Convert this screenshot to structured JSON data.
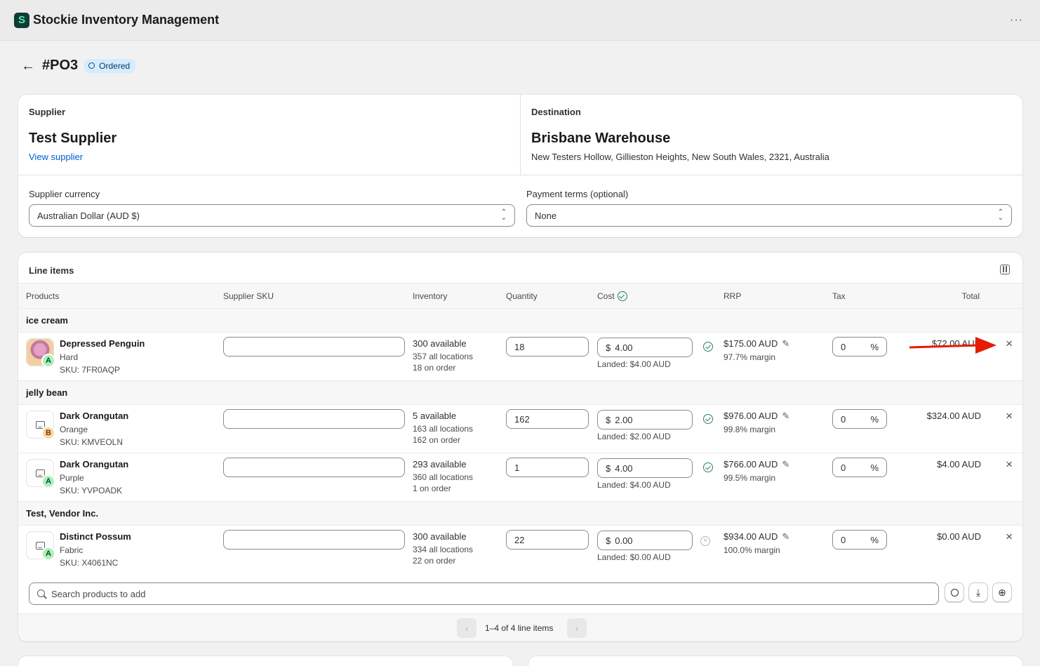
{
  "app": {
    "logo_letter": "S",
    "title": "Stockie Inventory Management",
    "more": "···"
  },
  "header": {
    "back": "←",
    "title": "#PO3",
    "status": "Ordered"
  },
  "supplier": {
    "label": "Supplier",
    "name": "Test Supplier",
    "link": "View supplier"
  },
  "destination": {
    "label": "Destination",
    "name": "Brisbane Warehouse",
    "address": "New Testers Hollow, Gillieston Heights, New South Wales, 2321, Australia"
  },
  "currency": {
    "label": "Supplier currency",
    "value": "Australian Dollar (AUD $)"
  },
  "payment_terms": {
    "label": "Payment terms (optional)",
    "value": "None"
  },
  "line_items": {
    "title": "Line items",
    "columns": {
      "products": "Products",
      "sku": "Supplier SKU",
      "inventory": "Inventory",
      "quantity": "Quantity",
      "cost": "Cost",
      "rrp": "RRP",
      "tax": "Tax",
      "total": "Total"
    },
    "groups": [
      "ice cream",
      "jelly bean",
      "Test, Vendor Inc."
    ],
    "rows": [
      {
        "name": "Depressed Penguin",
        "variant": "Hard",
        "sku": "SKU: 7FR0AQP",
        "grade": "A",
        "available": "300 available",
        "all_locations": "357 all locations",
        "on_order": "18 on order",
        "quantity": "18",
        "cost_prefix": "$",
        "cost": "4.00",
        "landed": "Landed: $4.00 AUD",
        "rrp": "$175.00 AUD",
        "margin": "97.7% margin",
        "tax": "0",
        "tax_unit": "%",
        "total": "$72.00 AUD"
      },
      {
        "name": "Dark Orangutan",
        "variant": "Orange",
        "sku": "SKU: KMVEOLN",
        "grade": "B",
        "available": "5 available",
        "all_locations": "163 all locations",
        "on_order": "162 on order",
        "quantity": "162",
        "cost_prefix": "$",
        "cost": "2.00",
        "landed": "Landed: $2.00 AUD",
        "rrp": "$976.00 AUD",
        "margin": "99.8% margin",
        "tax": "0",
        "tax_unit": "%",
        "total": "$324.00 AUD"
      },
      {
        "name": "Dark Orangutan",
        "variant": "Purple",
        "sku": "SKU: YVPOADK",
        "grade": "A",
        "available": "293 available",
        "all_locations": "360 all locations",
        "on_order": "1 on order",
        "quantity": "1",
        "cost_prefix": "$",
        "cost": "4.00",
        "landed": "Landed: $4.00 AUD",
        "rrp": "$766.00 AUD",
        "margin": "99.5% margin",
        "tax": "0",
        "tax_unit": "%",
        "total": "$4.00 AUD"
      },
      {
        "name": "Distinct Possum",
        "variant": "Fabric",
        "sku": "SKU: X4061NC",
        "grade": "A",
        "available": "300 available",
        "all_locations": "334 all locations",
        "on_order": "22 on order",
        "quantity": "22",
        "cost_prefix": "$",
        "cost": "0.00",
        "landed": "Landed: $0.00 AUD",
        "rrp": "$934.00 AUD",
        "margin": "100.0% margin",
        "tax": "0",
        "tax_unit": "%",
        "total": "$0.00 AUD"
      }
    ],
    "search_placeholder": "Search products to add",
    "pagination": "1–4 of 4 line items"
  },
  "icons": {
    "remove": "×",
    "pencil": "✎",
    "prev": "‹",
    "next": "›",
    "chevrons": "⌃⌄",
    "download": "⤓",
    "add": "⊕",
    "x_small": "×"
  },
  "colors": {
    "accent": "#005bd3",
    "success": "#29845a",
    "badge_bg": "#d5ebff",
    "annotation_arrow": "#e51c00"
  }
}
